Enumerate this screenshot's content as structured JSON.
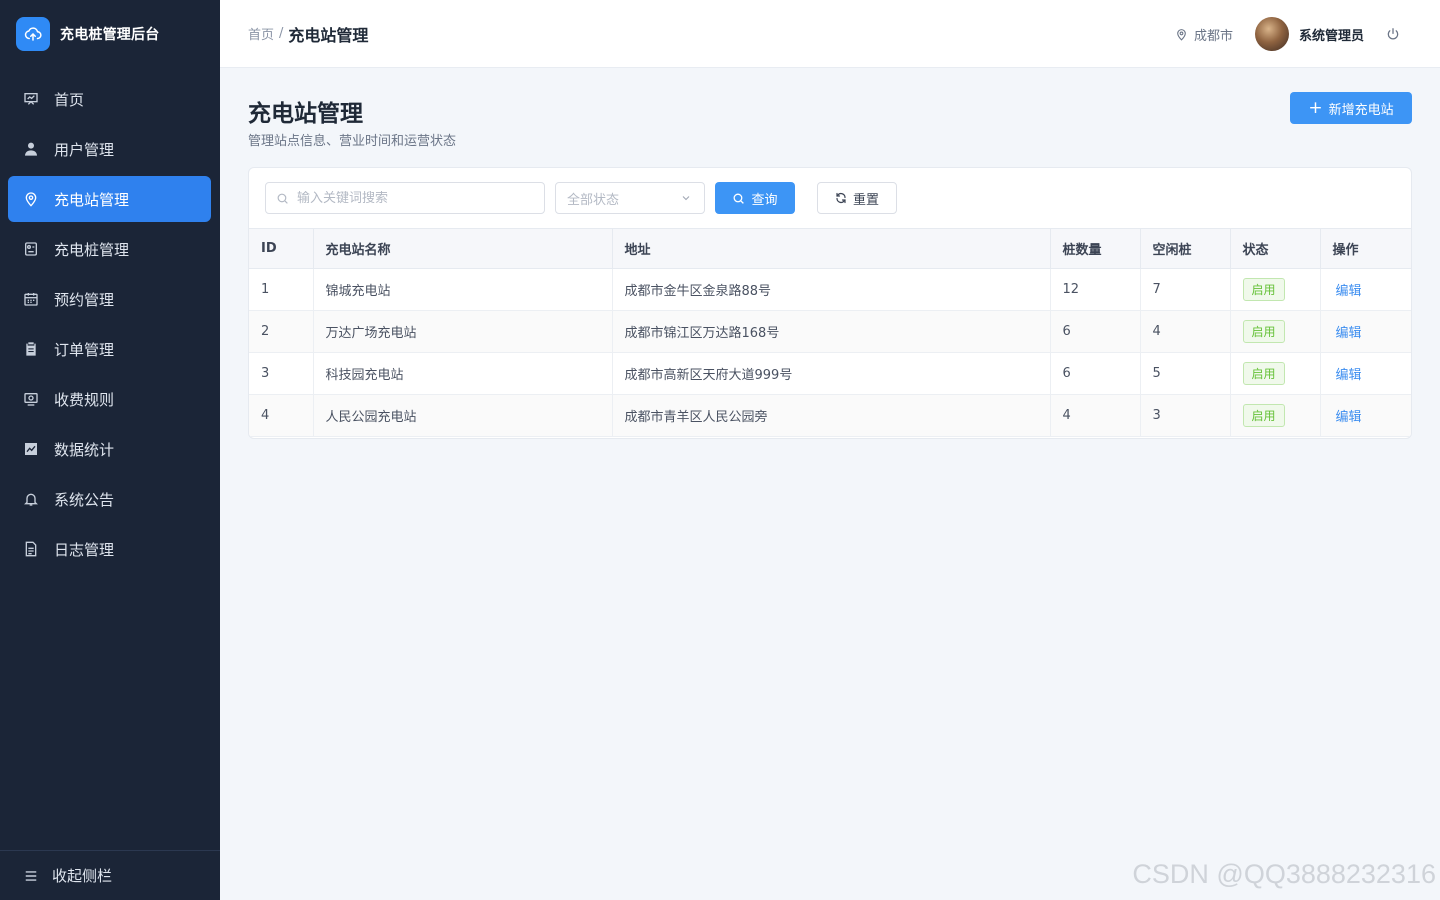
{
  "app": {
    "title": "充电桩管理后台"
  },
  "sidebar": {
    "items": [
      {
        "label": "首页",
        "icon": "dashboard-icon",
        "active": false
      },
      {
        "label": "用户管理",
        "icon": "user-icon",
        "active": false
      },
      {
        "label": "充电站管理",
        "icon": "location-icon",
        "active": true
      },
      {
        "label": "充电桩管理",
        "icon": "charger-icon",
        "active": false
      },
      {
        "label": "预约管理",
        "icon": "calendar-icon",
        "active": false
      },
      {
        "label": "订单管理",
        "icon": "clipboard-icon",
        "active": false
      },
      {
        "label": "收费规则",
        "icon": "money-icon",
        "active": false
      },
      {
        "label": "数据统计",
        "icon": "chart-icon",
        "active": false
      },
      {
        "label": "系统公告",
        "icon": "bell-icon",
        "active": false
      },
      {
        "label": "日志管理",
        "icon": "document-icon",
        "active": false
      }
    ],
    "collapse_label": "收起侧栏"
  },
  "header": {
    "breadcrumb_home": "首页",
    "breadcrumb_sep": "/",
    "breadcrumb_current": "充电站管理",
    "city": "成都市",
    "username": "系统管理员"
  },
  "main": {
    "title": "充电站管理",
    "subtitle": "管理站点信息、营业时间和运营状态",
    "add_button": "新增充电站",
    "search_placeholder": "输入关键词搜索",
    "status_select": "全部状态",
    "query_button": "查询",
    "reset_button": "重置",
    "columns": [
      "ID",
      "充电站名称",
      "地址",
      "桩数量",
      "空闲桩",
      "状态",
      "操作"
    ],
    "rows": [
      {
        "id": "1",
        "name": "锦城充电站",
        "address": "成都市金牛区金泉路88号",
        "piles": "12",
        "idle": "7",
        "status": "启用",
        "action": "编辑"
      },
      {
        "id": "2",
        "name": "万达广场充电站",
        "address": "成都市锦江区万达路168号",
        "piles": "6",
        "idle": "4",
        "status": "启用",
        "action": "编辑"
      },
      {
        "id": "3",
        "name": "科技园充电站",
        "address": "成都市高新区天府大道999号",
        "piles": "6",
        "idle": "5",
        "status": "启用",
        "action": "编辑"
      },
      {
        "id": "4",
        "name": "人民公园充电站",
        "address": "成都市青羊区人民公园旁",
        "piles": "4",
        "idle": "3",
        "status": "启用",
        "action": "编辑"
      }
    ]
  },
  "watermark": "CSDN @QQ3888232316",
  "colors": {
    "sidebar_bg": "#1b2537",
    "accent": "#2f81ee",
    "success": "#67c23a"
  }
}
